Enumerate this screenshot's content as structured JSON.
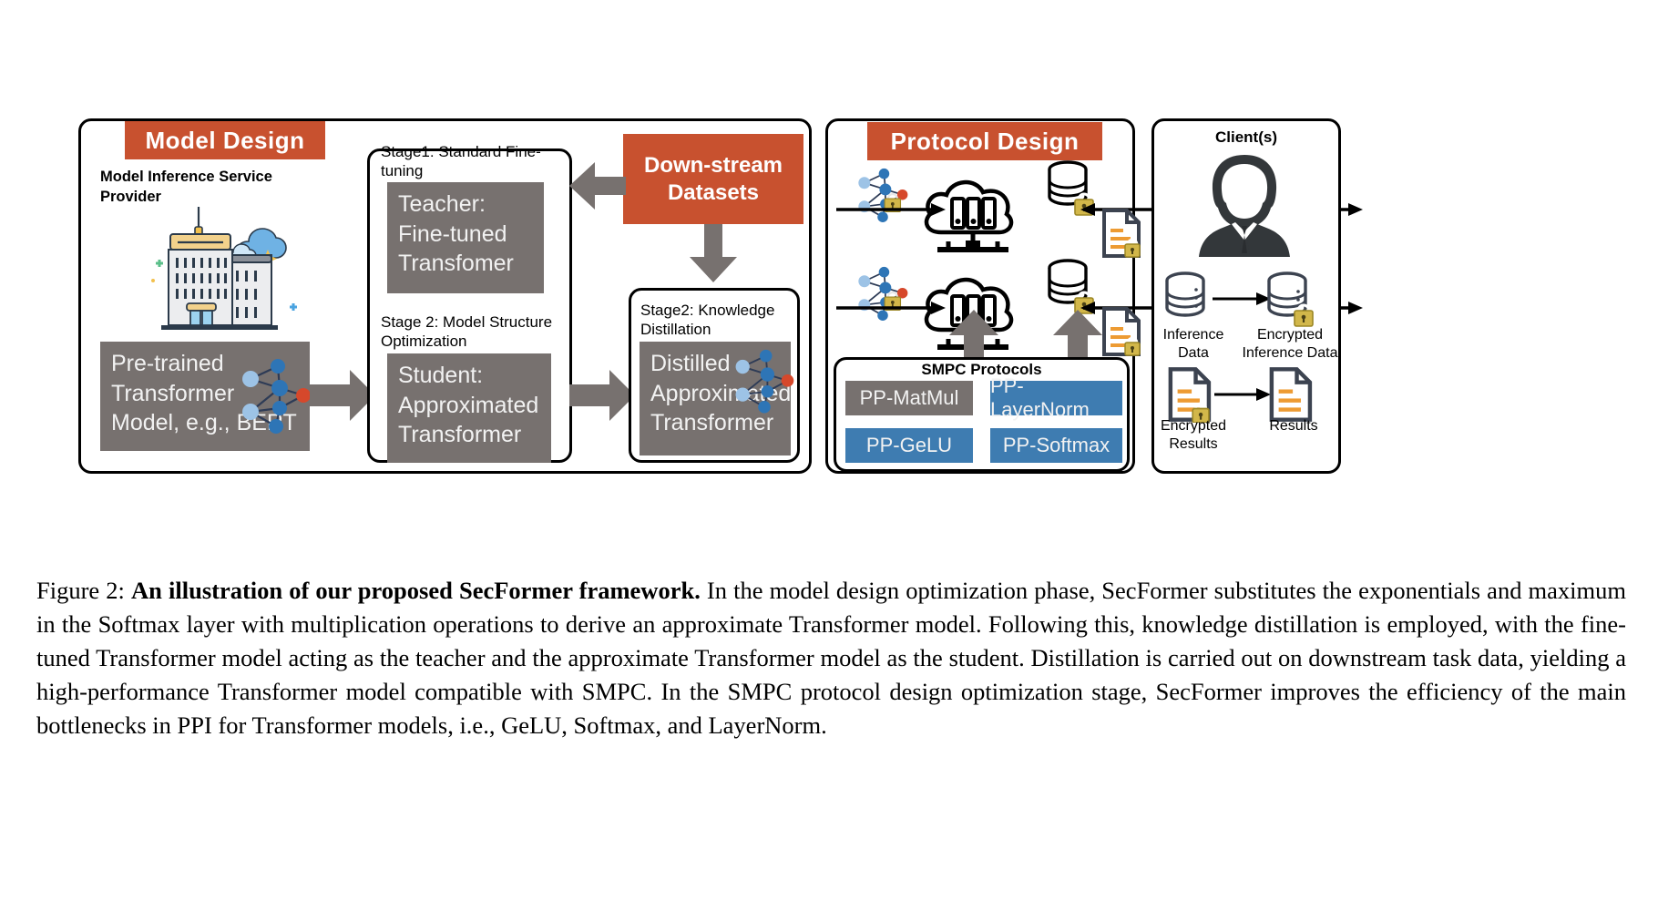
{
  "figure": {
    "colors": {
      "orange": "#C8512F",
      "grey": "#77716F",
      "blue": "#3E7CB1",
      "white": "#FFFFFF"
    },
    "left_panel": {
      "header": "Model Design",
      "provider_label": "Model Inference Service Provider",
      "pretrained_box": "Pre-trained Transformer Model, e.g., BERT"
    },
    "stage_panel": {
      "stage1_label": "Stage1: Standard Fine-tuning",
      "teacher_box": "Teacher: Fine-tuned Transfomer",
      "stage2_label": "Stage 2: Model Structure Optimization",
      "student_box": "Student: Approximated Transformer"
    },
    "datasets_box": "Down-stream Datasets",
    "distill_panel": {
      "stage2_label": "Stage2: Knowledge Distillation",
      "distilled_box": "Distilled Approximated Transformer"
    },
    "protocol_panel": {
      "header": "Protocol Design",
      "smpc_title": "SMPC Protocols",
      "protocols": [
        {
          "label": "PP-MatMul",
          "color": "grey"
        },
        {
          "label": "PP-LayerNorm",
          "color": "blue"
        },
        {
          "label": "PP-GeLU",
          "color": "blue"
        },
        {
          "label": "PP-Softmax",
          "color": "blue"
        }
      ]
    },
    "client_panel": {
      "header": "Client(s)",
      "inference_data_label": "Inference Data",
      "encrypted_inference_data_label": "Encrypted Inference Data",
      "encrypted_results_label": "Encrypted Results",
      "results_label": "Results"
    },
    "caption": {
      "figure_number": "Figure 2:",
      "bold_lead": "An illustration of our proposed SecFormer framework.",
      "body": " In the model design optimization phase, SecFormer substitutes the exponentials and maximum in the Softmax layer with multiplication operations to derive an approximate Transformer model. Following this, knowledge distillation is employed, with the fine-tuned Transformer model acting as the teacher and the approximate Transformer model as the student. Distillation is carried out on downstream task data, yielding a high-performance Transformer model compatible with SMPC. In the SMPC protocol design optimization stage, SecFormer improves the efficiency of the main bottlenecks in PPI for Transformer models, i.e., GeLU, Softmax, and LayerNorm."
    }
  }
}
